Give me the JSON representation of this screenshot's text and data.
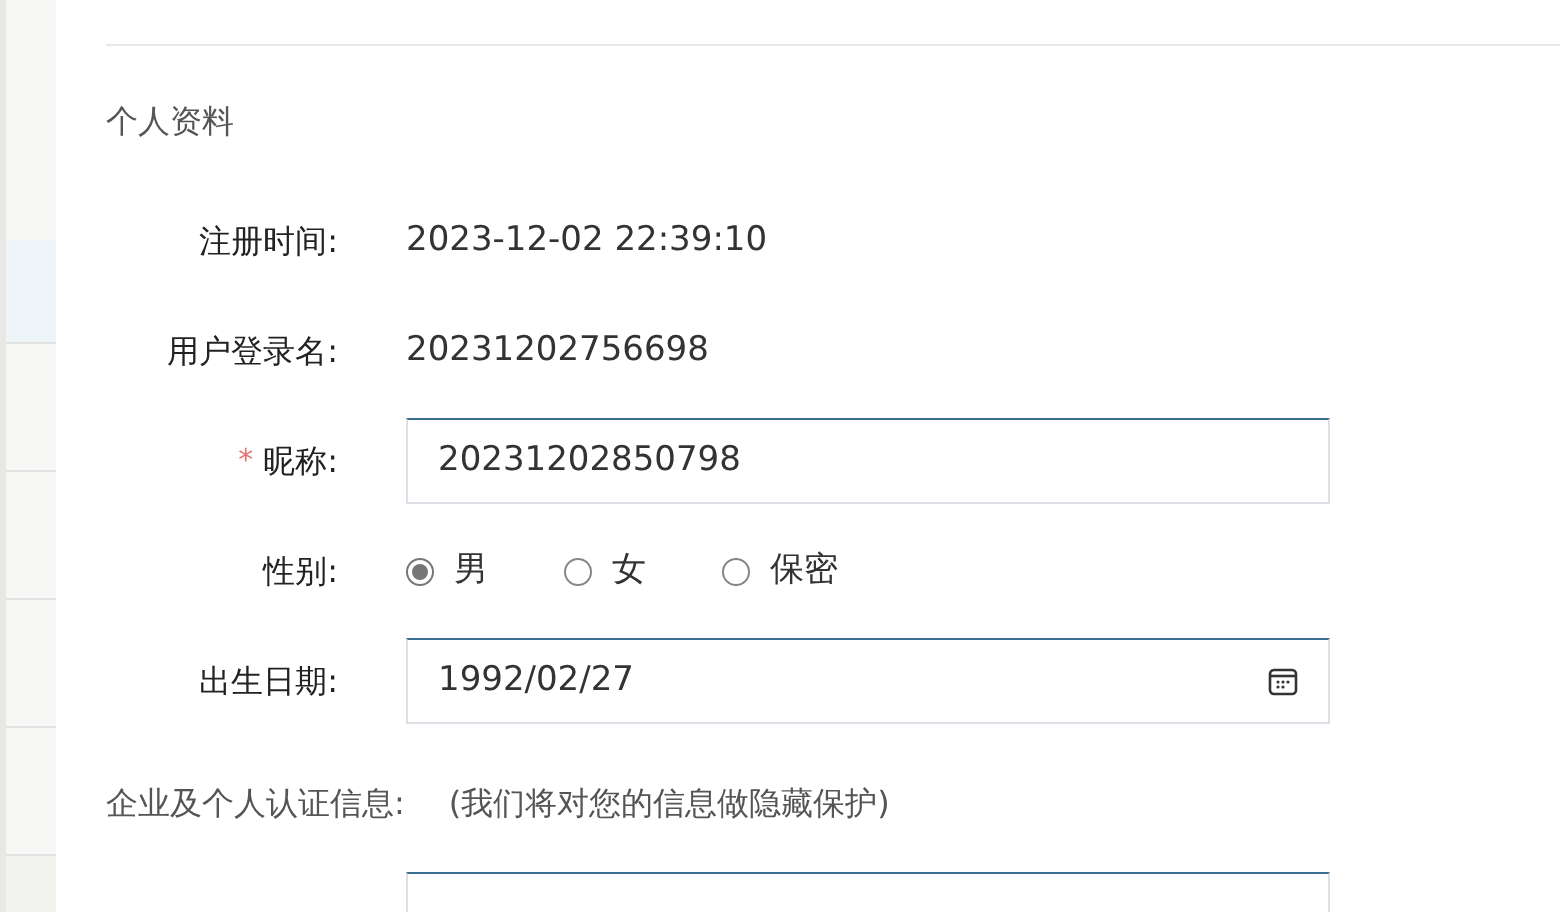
{
  "profile": {
    "title": "个人资料",
    "rows": [
      {
        "kind": "text",
        "label": "注册时间:",
        "value": "2023-12-02 22:39:10"
      },
      {
        "kind": "text",
        "label": "用户登录名:",
        "value": "20231202756698"
      },
      {
        "kind": "input",
        "label": "昵称:",
        "required_mark": "*",
        "value": "20231202850798"
      },
      {
        "kind": "radio",
        "label": "性别:",
        "options": [
          {
            "label": "男",
            "selected": true
          },
          {
            "label": "女",
            "selected": false
          },
          {
            "label": "保密",
            "selected": false
          }
        ]
      },
      {
        "kind": "date",
        "label": "出生日期:",
        "value": "1992/02/27"
      }
    ]
  },
  "certification": {
    "title": "企业及个人认证信息:",
    "note": "(我们将对您的信息做隐藏保护)",
    "field": {
      "kind": "input"
    }
  }
}
